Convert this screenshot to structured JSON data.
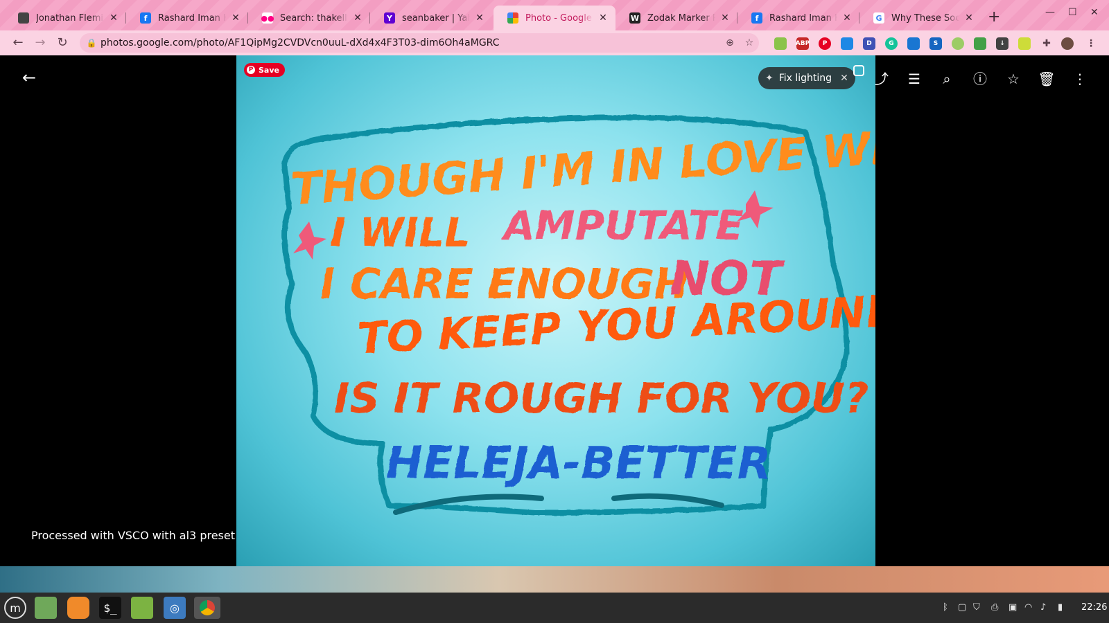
{
  "browser": {
    "tabs": [
      {
        "title": "Jonathan Fleming's",
        "favicon": "photo-icon",
        "color": "#444444"
      },
      {
        "title": "Rashard Iman Kelly",
        "favicon": "facebook-icon",
        "color": "#1877f2"
      },
      {
        "title": "Search: thakellys | F",
        "favicon": "flickr-icon",
        "color": "#ff0084"
      },
      {
        "title": "seanbaker | Yahoo",
        "favicon": "yahoo-icon",
        "color": "#6001d2"
      },
      {
        "title": "Photo - Google Ph",
        "favicon": "google-photos-icon",
        "color": "#fbbc04"
      },
      {
        "title": "Zodak Marker Pulls",
        "favicon": "w-icon",
        "color": "#222222"
      },
      {
        "title": "Rashard Iman Kelly",
        "favicon": "facebook-icon",
        "color": "#1877f2"
      },
      {
        "title": "Why These Social M",
        "favicon": "google-icon",
        "color": "#ffffff"
      }
    ],
    "active_tab_index": 4,
    "new_tab_label": "+",
    "url": "photos.google.com/photo/AF1QipMg2CVDVcn0uuL-dXd4x4F3T03-dim6Oh4aMGRC"
  },
  "viewer": {
    "pin_save_label": "Save",
    "fix_lighting_label": "Fix lighting",
    "caption": "Processed with VSCO with al3 preset",
    "toolbar_icons": [
      "share-icon",
      "edit-icon",
      "zoom-icon",
      "info-icon",
      "favorite-icon",
      "delete-icon",
      "more-icon"
    ]
  },
  "photo_text": {
    "line1": "THOUGH I'M IN LOVE WITH IT",
    "line2a": "I WILL",
    "line2b": "AMPUTATE",
    "line3a": "I CARE ENOUGH",
    "line3b": "NOT",
    "line4": "TO KEEP YOU AROUND",
    "line5": "IS IT ROUGH FOR YOU?",
    "signature": "HELEJA-BETTER"
  },
  "taskbar": {
    "clock": "22:26"
  }
}
